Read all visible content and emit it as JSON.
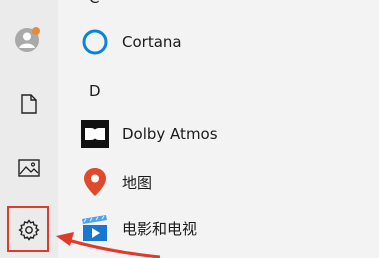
{
  "sidebar": {
    "items": [
      {
        "name": "user-account",
        "icon": "user-avatar-icon"
      },
      {
        "name": "documents",
        "icon": "document-icon"
      },
      {
        "name": "pictures",
        "icon": "picture-icon"
      },
      {
        "name": "settings",
        "icon": "gear-icon"
      }
    ]
  },
  "app_list": {
    "partial_letter": "C",
    "letter_d": "D",
    "items": [
      {
        "label": "Cortana",
        "icon": "cortana-ring-icon"
      },
      {
        "label": "Dolby Atmos",
        "icon": "dolby-icon"
      },
      {
        "label": "地图",
        "icon": "map-pin-icon"
      },
      {
        "label": "电影和电视",
        "icon": "movies-tv-icon"
      }
    ]
  },
  "annotation": {
    "color": "#e03a2a",
    "highlighted_item": "settings"
  },
  "colors": {
    "cortana_blue": "#0a84d6",
    "map_red": "#e0492b",
    "movies_blue": "#1976d2"
  }
}
